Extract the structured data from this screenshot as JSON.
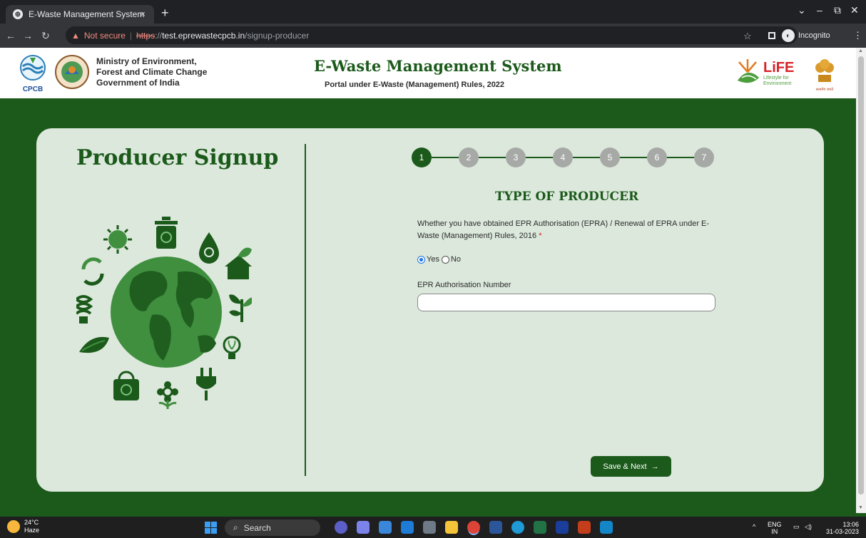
{
  "browser": {
    "tab_title": "E-Waste Management System",
    "tab_close": "×",
    "new_tab": "+",
    "url_warning": "Not secure",
    "url_separator": "|",
    "url_scheme": "https",
    "url_scheme_sep": "://",
    "url_host": "test.eprewastecpcb.in",
    "url_path": "/signup-producer",
    "profile_label": "Incognito"
  },
  "header": {
    "ministry_line1": "Ministry of Environment,",
    "ministry_line2": "Forest and Climate Change",
    "ministry_line3": "Government of India",
    "title": "E-Waste Management System",
    "subtitle": "Portal under E-Waste (Management) Rules, 2022",
    "cpcb_text": "CPCB",
    "life_text": "LiFE",
    "life_tagline1": "Lifestyle for",
    "life_tagline2": "Environment",
    "emblem_text": "सत्यमेव जयते"
  },
  "signup": {
    "page_title": "Producer Signup",
    "steps": [
      "1",
      "2",
      "3",
      "4",
      "5",
      "6",
      "7"
    ],
    "active_step": 1,
    "section_title": "TYPE OF PRODUCER",
    "question": "Whether you have obtained EPR Authorisation (EPRA) / Renewal of EPRA under E-Waste (Management) Rules, 2016",
    "required_mark": "*",
    "option_yes": "Yes",
    "option_no": "No",
    "selected_option": "Yes",
    "field_label": "EPR Authorisation Number",
    "field_value": "",
    "save_label": "Save & Next",
    "save_icon": "→"
  },
  "taskbar": {
    "temperature": "24°C",
    "weather": "Haze",
    "search_label": "Search",
    "lang_line1": "ENG",
    "lang_line2": "IN",
    "time": "13:06",
    "date": "31-03-2023"
  },
  "colors": {
    "brand_green": "#1b5a1b",
    "card_bg": "#dce8dc",
    "step_inactive": "#a7a9a7",
    "globe_green": "#3f8f3f"
  }
}
